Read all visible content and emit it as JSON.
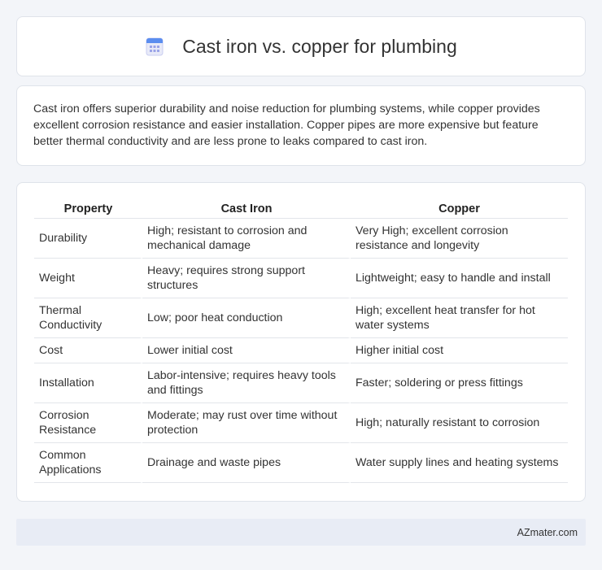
{
  "header": {
    "title": "Cast iron vs. copper for plumbing",
    "icon": "calendar-icon"
  },
  "summary": {
    "text": "Cast iron offers superior durability and noise reduction for plumbing systems, while copper provides excellent corrosion resistance and easier installation. Copper pipes are more expensive but feature better thermal conductivity and are less prone to leaks compared to cast iron."
  },
  "table": {
    "headers": [
      "Property",
      "Cast Iron",
      "Copper"
    ],
    "rows": [
      [
        "Durability",
        "High; resistant to corrosion and mechanical damage",
        "Very High; excellent corrosion resistance and longevity"
      ],
      [
        "Weight",
        "Heavy; requires strong support structures",
        "Lightweight; easy to handle and install"
      ],
      [
        "Thermal Conductivity",
        "Low; poor heat conduction",
        "High; excellent heat transfer for hot water systems"
      ],
      [
        "Cost",
        "Lower initial cost",
        "Higher initial cost"
      ],
      [
        "Installation",
        "Labor-intensive; requires heavy tools and fittings",
        "Faster; soldering or press fittings"
      ],
      [
        "Corrosion Resistance",
        "Moderate; may rust over time without protection",
        "High; naturally resistant to corrosion"
      ],
      [
        "Common Applications",
        "Drainage and waste pipes",
        "Water supply lines and heating systems"
      ]
    ]
  },
  "footer": {
    "text": "AZmater.com"
  },
  "colors": {
    "background": "#f3f5f9",
    "card": "#ffffff",
    "footer": "#e8ecf5",
    "icon_accent": "#5b8def"
  }
}
